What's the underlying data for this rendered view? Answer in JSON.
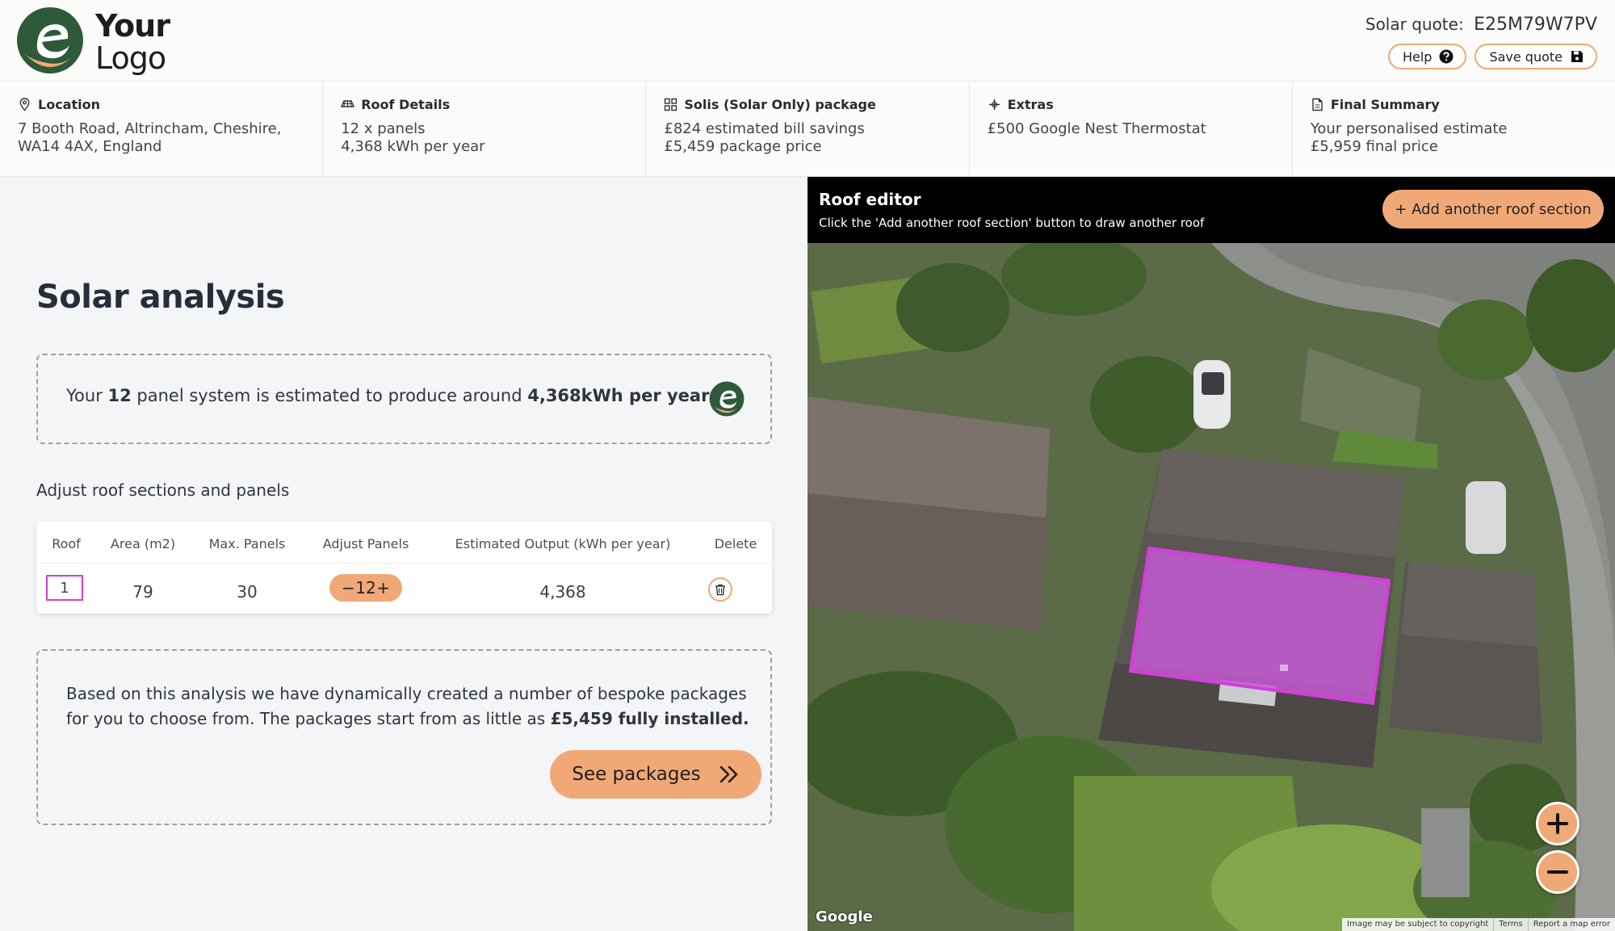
{
  "brand": {
    "logo_line1": "Your",
    "logo_line2": "Logo",
    "accent": "#f0a877",
    "dark_green": "#2f5a3a"
  },
  "header": {
    "quote_label": "Solar quote:",
    "quote_code": "E25M79W7PV",
    "help_label": "Help",
    "save_label": "Save quote"
  },
  "steps": [
    {
      "title": "Location",
      "icon": "location-pin-icon",
      "lines": [
        "7 Booth Road, Altrincham, Cheshire,",
        "WA14 4AX, England"
      ]
    },
    {
      "title": "Roof Details",
      "icon": "roof-icon",
      "lines": [
        "12 x panels",
        "4,368 kWh per year"
      ]
    },
    {
      "title": "Solis (Solar Only) package",
      "icon": "grid-icon",
      "lines": [
        "£824 estimated bill savings",
        "£5,459 package price"
      ]
    },
    {
      "title": "Extras",
      "icon": "plus-icon",
      "lines": [
        "£500 Google Nest Thermostat"
      ]
    },
    {
      "title": "Final Summary",
      "icon": "document-icon",
      "lines": [
        "Your personalised estimate",
        "£5,959 final price"
      ]
    }
  ],
  "analysis": {
    "title": "Solar analysis",
    "estimate_pre": "Your ",
    "estimate_panels": "12",
    "estimate_mid": " panel system is estimated to produce around ",
    "estimate_output": "4,368kWh per year",
    "adjust_title": "Adjust roof sections and panels",
    "table": {
      "headers": [
        "Roof",
        "Area (m2)",
        "Max. Panels",
        "Adjust Panels",
        "Estimated Output (kWh per year)",
        "Delete"
      ],
      "rows": [
        {
          "roof": "1",
          "area": "79",
          "max_panels": "30",
          "panels": "12",
          "output": "4,368"
        }
      ],
      "minus": "−",
      "plus": "+"
    },
    "packages_text_1": "Based on this analysis we have dynamically created a number of bespoke packages for you to choose from. The packages start from as little as ",
    "packages_price": "£5,459 fully installed.",
    "see_packages_label": "See packages"
  },
  "roof_editor": {
    "title": "Roof editor",
    "subtitle": "Click the 'Add another roof section' button to draw another roof",
    "add_label": "+ Add another roof section",
    "zoom_in": "+",
    "zoom_out": "−",
    "google_label": "Google",
    "attribution": [
      "Image may be subject to copyright",
      "Terms",
      "Report a map error"
    ],
    "selection_color": "#d23fd8"
  }
}
